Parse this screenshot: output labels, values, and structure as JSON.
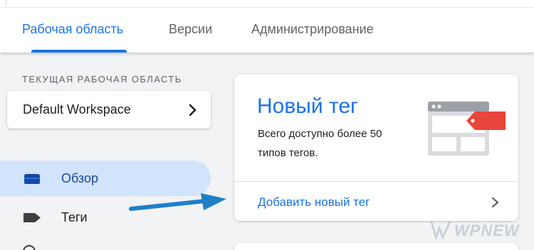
{
  "tabs": [
    {
      "label": "Рабочая область",
      "active": true
    },
    {
      "label": "Версии",
      "active": false
    },
    {
      "label": "Администрирование",
      "active": false
    }
  ],
  "sidebar": {
    "section_label": "ТЕКУЩАЯ РАБОЧАЯ ОБЛАСТЬ",
    "workspace_name": "Default Workspace",
    "items": [
      {
        "label": "Обзор",
        "icon": "overview-icon",
        "active": true
      },
      {
        "label": "Теги",
        "icon": "tag-icon",
        "active": false
      }
    ]
  },
  "tag_card": {
    "title": "Новый тег",
    "description": "Всего доступно более 50 типов тегов.",
    "add_link": "Добавить новый тег",
    "illustration": "tag-illustration-icon"
  },
  "watermark": {
    "text": "WPNEW"
  },
  "colors": {
    "accent": "#1a73e8",
    "active_nav_bg": "#d2e3fc",
    "background": "#f1f3f4",
    "tag_red": "#e8453c",
    "arrow_blue": "#1f7fc7"
  }
}
